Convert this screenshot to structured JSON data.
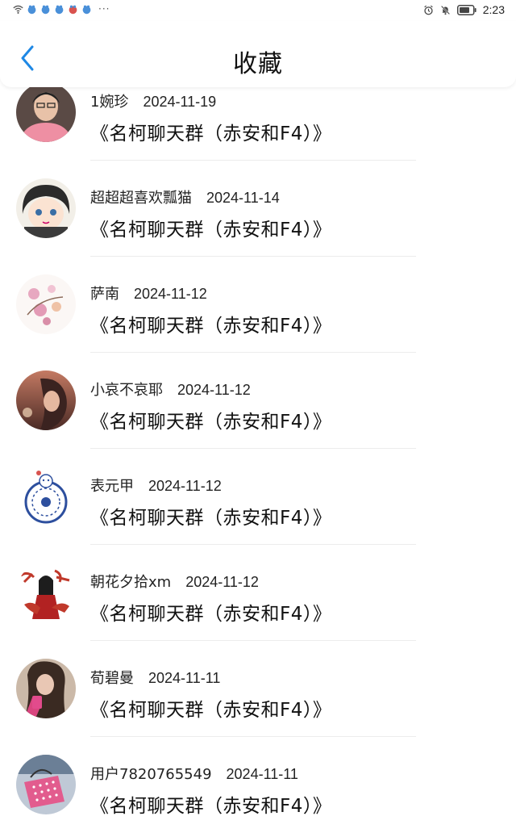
{
  "status_bar": {
    "overflow": "···",
    "time": "2:23"
  },
  "header": {
    "title": "收藏"
  },
  "favorites": [
    {
      "user": "1婉珍",
      "date": "2024-11-19",
      "group": "《名柯聊天群（赤安和F4）》"
    },
    {
      "user": "超超超喜欢瓢猫",
      "date": "2024-11-14",
      "group": "《名柯聊天群（赤安和F4）》"
    },
    {
      "user": "萨南",
      "date": "2024-11-12",
      "group": "《名柯聊天群（赤安和F4）》"
    },
    {
      "user": "小哀不哀耶",
      "date": "2024-11-12",
      "group": "《名柯聊天群（赤安和F4）》"
    },
    {
      "user": "表元甲",
      "date": "2024-11-12",
      "group": "《名柯聊天群（赤安和F4）》"
    },
    {
      "user": "朝花夕拾xm",
      "date": "2024-11-12",
      "group": "《名柯聊天群（赤安和F4）》"
    },
    {
      "user": "荀碧曼",
      "date": "2024-11-11",
      "group": "《名柯聊天群（赤安和F4）》"
    },
    {
      "user": "用户7820765549",
      "date": "2024-11-11",
      "group": "《名柯聊天群（赤安和F4）》"
    }
  ],
  "colors": {
    "accent": "#1e88e5",
    "divider": "#ececec"
  },
  "icons": {
    "back": "chevron-left-icon",
    "wifi": "wifi-icon",
    "alarm": "alarm-icon",
    "mute": "bell-off-icon",
    "battery": "battery-icon"
  }
}
